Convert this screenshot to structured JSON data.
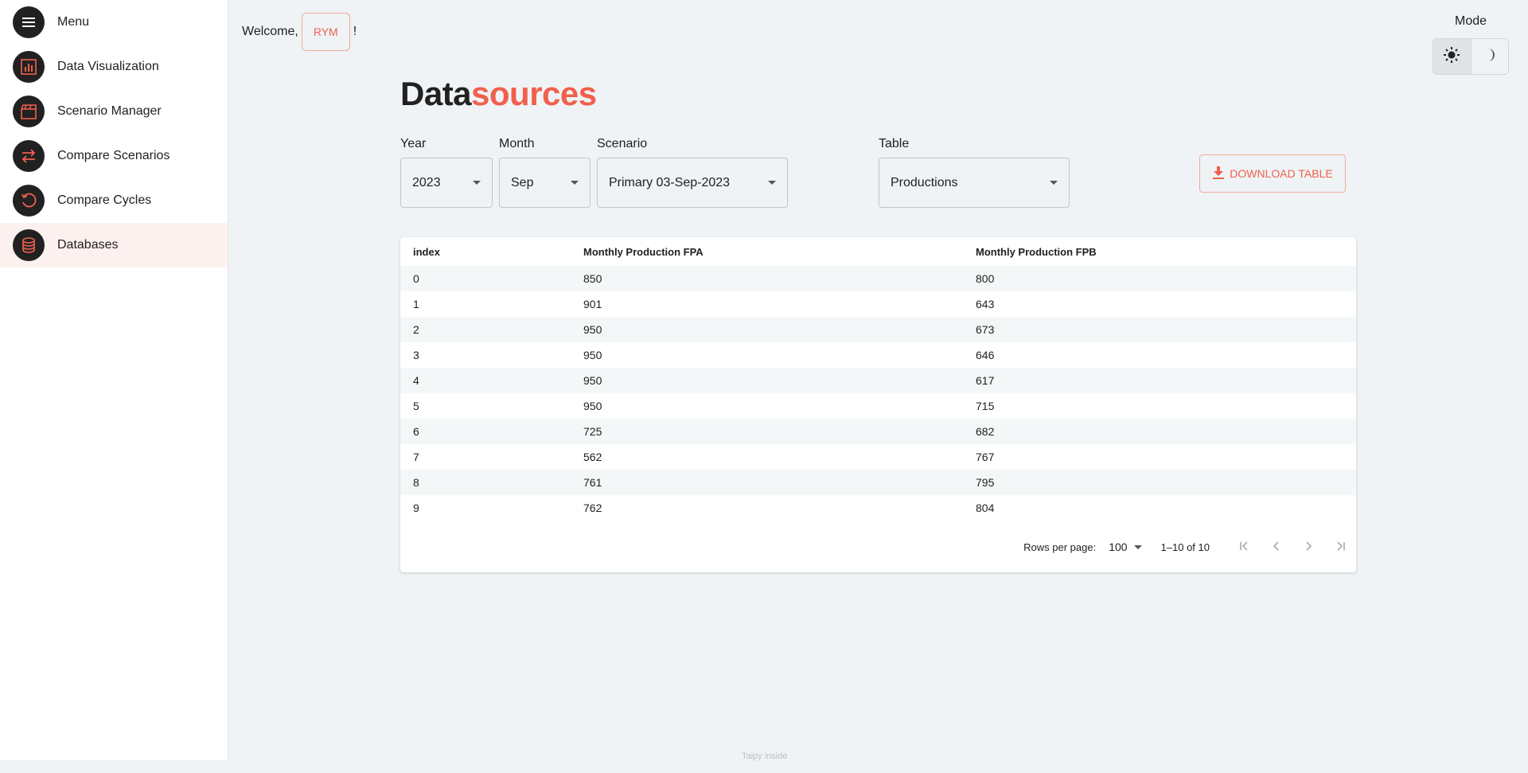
{
  "sidebar": {
    "items": [
      {
        "label": "Menu",
        "icon": "menu-icon"
      },
      {
        "label": "Data Visualization",
        "icon": "chart-icon"
      },
      {
        "label": "Scenario Manager",
        "icon": "clapperboard-icon"
      },
      {
        "label": "Compare Scenarios",
        "icon": "swap-arrows-icon"
      },
      {
        "label": "Compare Cycles",
        "icon": "cycle-icon"
      },
      {
        "label": "Databases",
        "icon": "database-icon"
      }
    ]
  },
  "header": {
    "welcome": "Welcome,",
    "user": "RYM",
    "exclaim": "!",
    "mode_label": "Mode"
  },
  "page": {
    "title_main": "Data",
    "title_accent": "sources"
  },
  "filters": {
    "year": {
      "label": "Year",
      "value": "2023"
    },
    "month": {
      "label": "Month",
      "value": "Sep"
    },
    "scenario": {
      "label": "Scenario",
      "value": "Primary 03-Sep-2023"
    },
    "table": {
      "label": "Table",
      "value": "Productions"
    }
  },
  "download": {
    "label": "DOWNLOAD TABLE"
  },
  "table": {
    "headers": [
      "index",
      "Monthly Production FPA",
      "Monthly Production FPB"
    ],
    "rows": [
      [
        "0",
        "850",
        "800"
      ],
      [
        "1",
        "901",
        "643"
      ],
      [
        "2",
        "950",
        "673"
      ],
      [
        "3",
        "950",
        "646"
      ],
      [
        "4",
        "950",
        "617"
      ],
      [
        "5",
        "950",
        "715"
      ],
      [
        "6",
        "725",
        "682"
      ],
      [
        "7",
        "562",
        "767"
      ],
      [
        "8",
        "761",
        "795"
      ],
      [
        "9",
        "762",
        "804"
      ]
    ]
  },
  "pager": {
    "rows_per_page_label": "Rows per page:",
    "rows_per_page_value": "100",
    "range": "1–10 of 10"
  },
  "footer": {
    "text": "Taipy inside"
  },
  "colors": {
    "accent": "#f0604d",
    "icon_bg": "#212121",
    "background": "#eff3f5"
  }
}
